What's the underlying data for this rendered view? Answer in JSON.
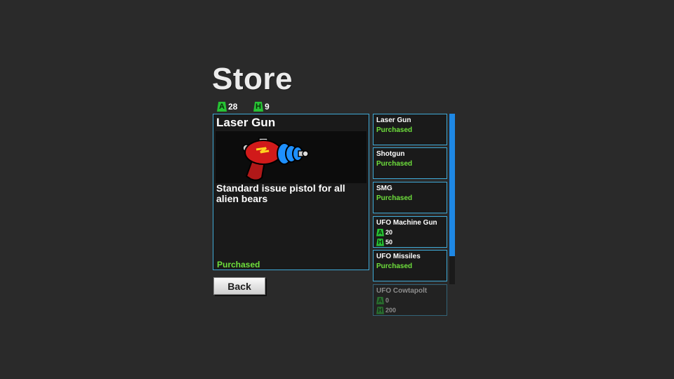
{
  "store": {
    "title": "Store"
  },
  "currency": {
    "a": {
      "icon": "a-currency-icon",
      "letter": "A",
      "value": "28"
    },
    "h": {
      "icon": "h-currency-icon",
      "letter": "H",
      "value": "9"
    }
  },
  "detail": {
    "name": "Laser Gun",
    "image": "laser-gun-image",
    "description": "Standard issue pistol for all alien bears",
    "status": "Purchased"
  },
  "back_label": "Back",
  "items": [
    {
      "name": "Laser Gun",
      "status": "Purchased"
    },
    {
      "name": "Shotgun",
      "status": "Purchased"
    },
    {
      "name": "SMG",
      "status": "Purchased"
    },
    {
      "name": "UFO Machine Gun",
      "price_a": "20",
      "price_h": "50"
    },
    {
      "name": "UFO Missiles",
      "status": "Purchased"
    },
    {
      "name": "UFO Cowtapolt",
      "price_a": "0",
      "price_h": "200"
    }
  ],
  "letters": {
    "a": "A",
    "h": "H"
  },
  "colors": {
    "accent": "#3fa9d6",
    "purchased": "#6ee03c",
    "currency": "#27c234",
    "scrollbar": "#1e88e5"
  }
}
